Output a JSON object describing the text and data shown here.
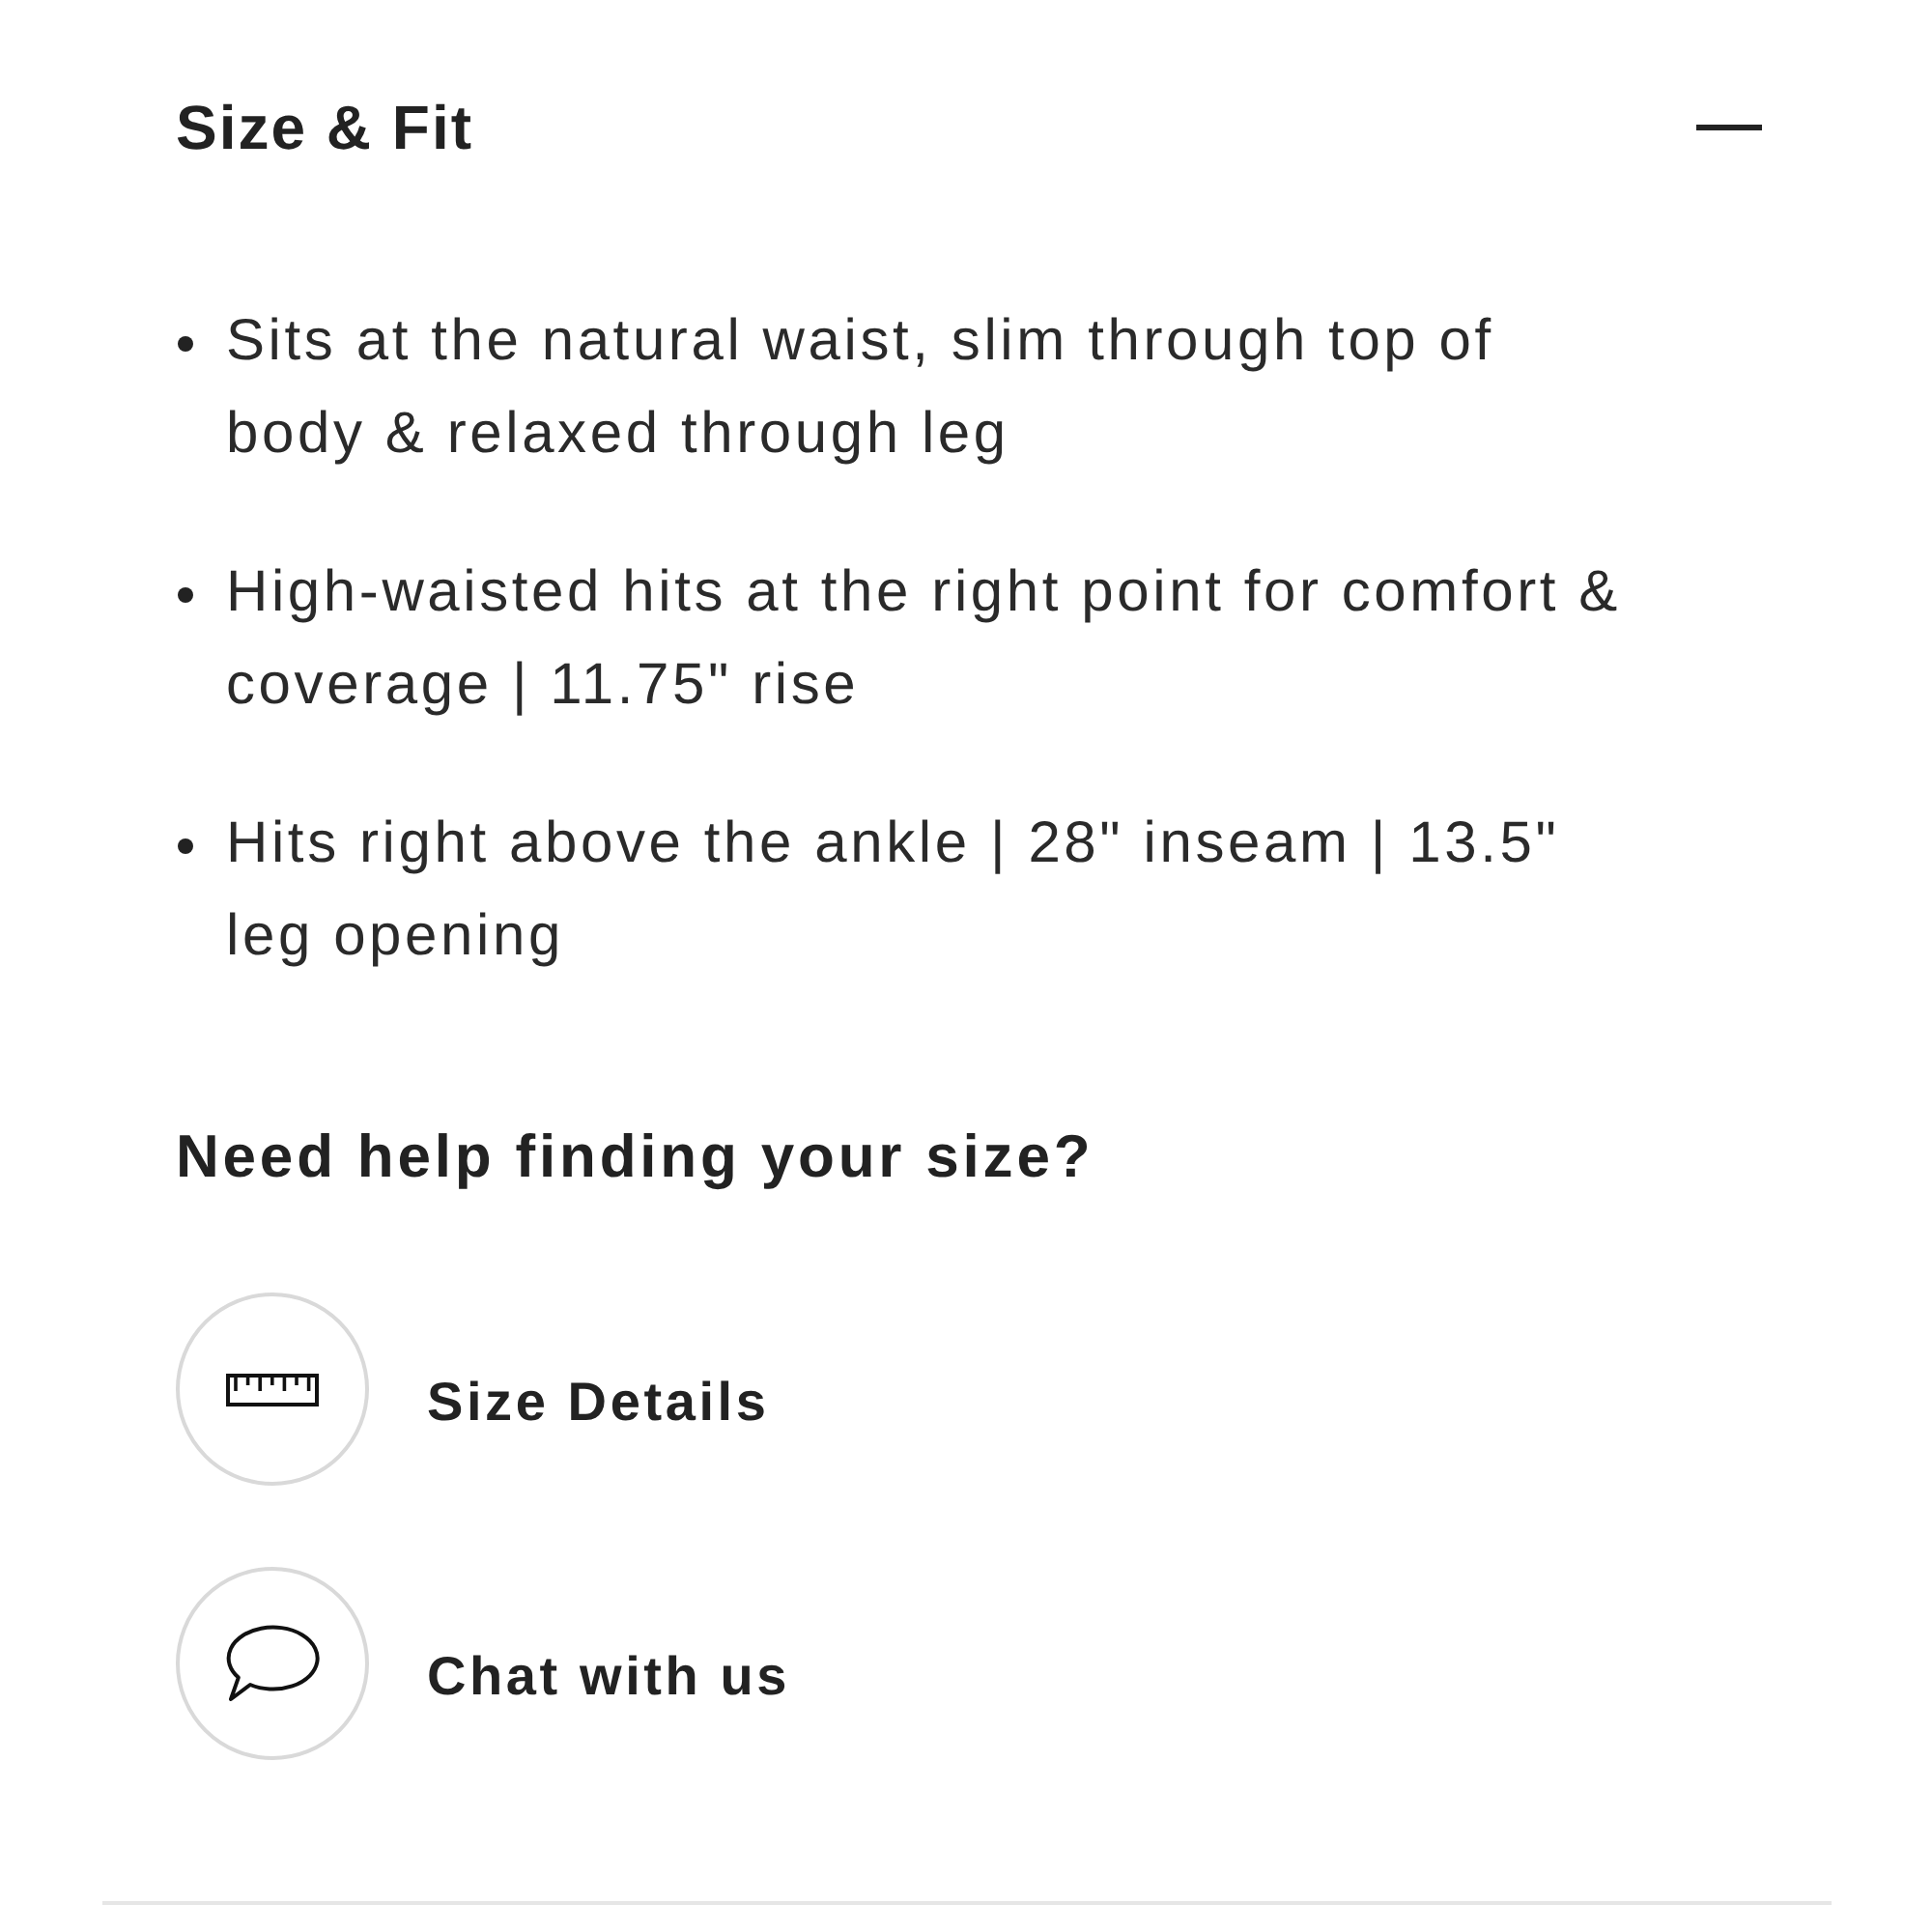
{
  "section": {
    "title": "Size & Fit",
    "expanded": true
  },
  "bullets": [
    "Sits at the natural waist, slim through top of body & relaxed through leg",
    "High-waisted hits at the right point for comfort & coverage | 11.75\" rise",
    "Hits right above the ankle | 28\" inseam | 13.5\" leg opening"
  ],
  "help": {
    "title": "Need help finding your size?",
    "actions": [
      {
        "kind": "ruler",
        "label": "Size Details"
      },
      {
        "kind": "chat",
        "label": "Chat with us"
      }
    ]
  }
}
